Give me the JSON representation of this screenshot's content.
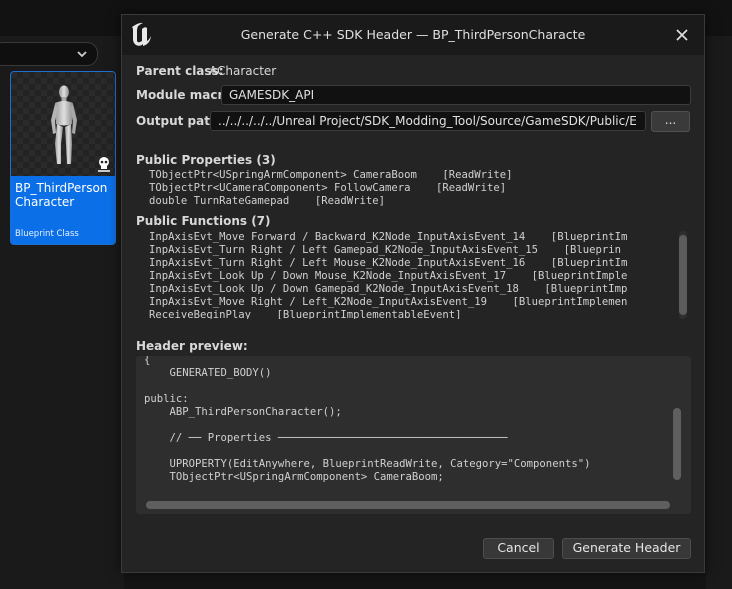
{
  "asset": {
    "name": "BP_ThirdPerson Character",
    "type": "Blueprint Class"
  },
  "dialog": {
    "title": "Generate C++ SDK Header — BP_ThirdPersonCharacte",
    "parent_class_label": "Parent class:",
    "parent_class_value": "ACharacter",
    "module_macro_label": "Module macro:",
    "module_macro_value": "GAMESDK_API",
    "output_path_label": "Output path:",
    "output_path_value": "../../../../../Unreal Project/SDK_Modding_Tool/Source/GameSDK/Public/E",
    "browse_label": "...",
    "properties_heading": "Public Properties (3)",
    "properties": [
      "TObjectPtr<USpringArmComponent> CameraBoom    [ReadWrite]",
      "TObjectPtr<UCameraComponent> FollowCamera    [ReadWrite]",
      "double TurnRateGamepad    [ReadWrite]"
    ],
    "functions_heading": "Public Functions (7)",
    "functions": [
      "InpAxisEvt_Move Forward / Backward_K2Node_InputAxisEvent_14    [BlueprintIm",
      "InpAxisEvt_Turn Right / Left Gamepad_K2Node_InputAxisEvent_15    [Blueprin",
      "InpAxisEvt_Turn Right / Left Mouse_K2Node_InputAxisEvent_16    [BlueprintIm",
      "InpAxisEvt_Look Up / Down Mouse_K2Node_InputAxisEvent_17    [BlueprintImple",
      "InpAxisEvt_Look Up / Down Gamepad_K2Node_InputAxisEvent_18    [BlueprintImp",
      "InpAxisEvt_Move Right / Left_K2Node_InputAxisEvent_19    [BlueprintImplemen",
      "ReceiveBeginPlay    [BlueprintImplementableEvent]"
    ],
    "preview_heading": "Header preview:",
    "preview_lines": [
      "{",
      "    GENERATED_BODY()",
      "",
      "public:",
      "    ABP_ThirdPersonCharacter();",
      "",
      "    // ── Properties ────────────────────────────────────",
      "",
      "    UPROPERTY(EditAnywhere, BlueprintReadWrite, Category=\"Components\")",
      "    TObjectPtr<USpringArmComponent> CameraBoom;"
    ],
    "cancel_label": "Cancel",
    "generate_label": "Generate Header"
  },
  "icons": {
    "logo": "unreal-logo-icon",
    "close": "close-icon",
    "dropdown": "chevron-down-icon",
    "skeleton": "skeleton-icon"
  },
  "colors": {
    "accent": "#0b70e8",
    "dialog_bg": "#242424",
    "field_bg": "#111111"
  }
}
